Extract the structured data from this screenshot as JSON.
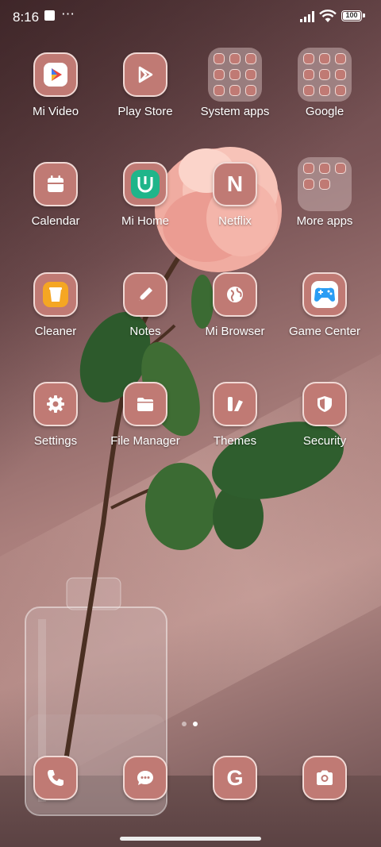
{
  "status_bar": {
    "time": "8:16",
    "battery": "100",
    "more_indicator": "⋯"
  },
  "apps": [
    {
      "label": "Mi Video",
      "icon": "mi-video-icon"
    },
    {
      "label": "Play Store",
      "icon": "play-store-icon"
    },
    {
      "label": "System apps",
      "icon": "folder-icon"
    },
    {
      "label": "Google",
      "icon": "folder-icon"
    },
    {
      "label": "Calendar",
      "icon": "calendar-icon"
    },
    {
      "label": "Mi Home",
      "icon": "mi-home-icon"
    },
    {
      "label": "Netflix",
      "icon": "netflix-icon",
      "glyph": "N"
    },
    {
      "label": "More apps",
      "icon": "folder-icon"
    },
    {
      "label": "Cleaner",
      "icon": "cleaner-icon"
    },
    {
      "label": "Notes",
      "icon": "notes-icon"
    },
    {
      "label": "Mi Browser",
      "icon": "browser-icon"
    },
    {
      "label": "Game Center",
      "icon": "game-center-icon"
    },
    {
      "label": "Settings",
      "icon": "gear-icon"
    },
    {
      "label": "File Manager",
      "icon": "folder-file-icon"
    },
    {
      "label": "Themes",
      "icon": "themes-icon"
    },
    {
      "label": "Security",
      "icon": "shield-icon"
    }
  ],
  "dock": [
    {
      "icon": "phone-icon"
    },
    {
      "icon": "messages-icon"
    },
    {
      "icon": "google-icon",
      "glyph": "G"
    },
    {
      "icon": "camera-icon"
    }
  ],
  "pager": {
    "pages": 2,
    "active": 2
  },
  "colors": {
    "tile": "#c07a74",
    "tile_border": "#f1d9d5",
    "accent_green": "#1fb58a"
  }
}
